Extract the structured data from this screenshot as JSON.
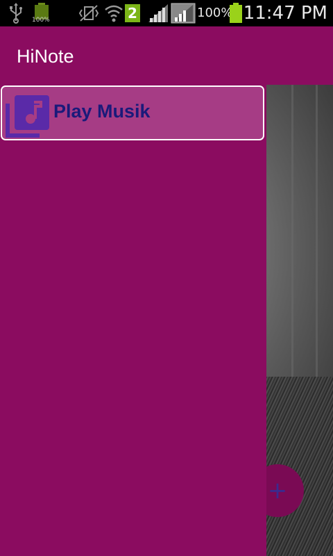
{
  "status_bar": {
    "usb_icon": "usb-icon",
    "battery_small_label": "100%",
    "signal_badge": "2",
    "battery_percent": "100%",
    "time": "11:47 PM"
  },
  "app_bar": {
    "title": "HiNote"
  },
  "drawer": {
    "items": [
      {
        "label": "Play Musik",
        "icon": "music-library-icon"
      }
    ]
  },
  "fab": {
    "icon": "plus-icon",
    "label": "+"
  },
  "colors": {
    "primary": "#8b0c60",
    "selected_item": "#a63c85",
    "item_text": "#1a1a7a",
    "icon_purple": "#5a2aa8"
  }
}
